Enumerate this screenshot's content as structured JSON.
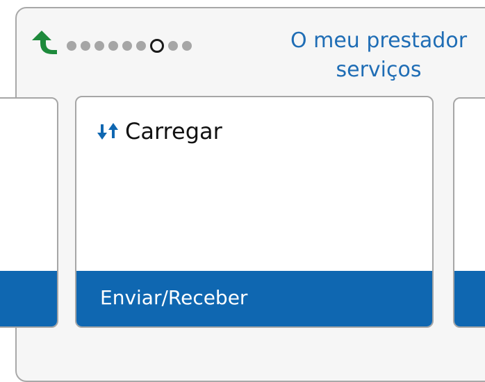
{
  "header": {
    "title_line1": "O meu prestador",
    "title_line2": "serviços",
    "back_icon": "back-up-arrow-icon",
    "pager": {
      "total": 9,
      "current_index": 6
    }
  },
  "tiles": {
    "main": {
      "title": "Carregar",
      "icon": "down-up-arrows-icon",
      "action_label": "Enviar/Receber"
    }
  },
  "colors": {
    "accent_blue": "#0f67b1",
    "title_blue": "#1f6db5",
    "back_arrow_green": "#1e8a3c",
    "dot_gray": "#a6a6a6"
  }
}
